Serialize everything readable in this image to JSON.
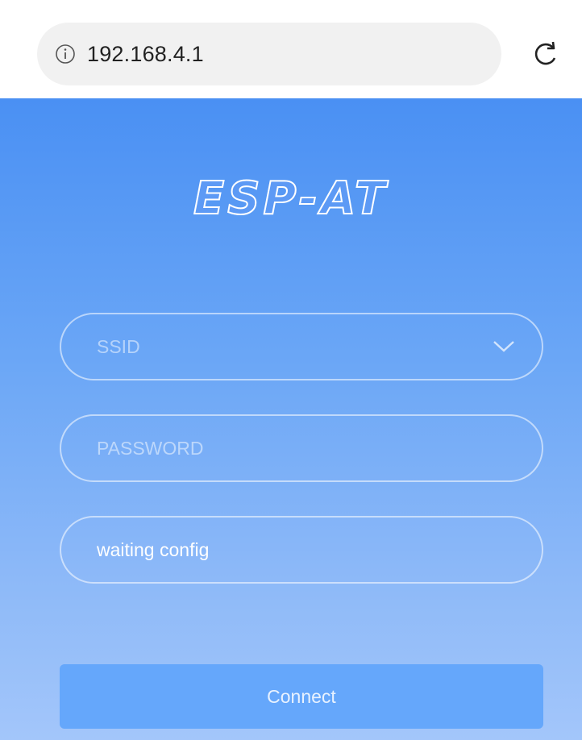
{
  "browser": {
    "url": "192.168.4.1",
    "info_icon": "info-icon",
    "reload_icon": "reload-icon"
  },
  "app": {
    "logo": "ESP-AT",
    "ssid_placeholder": "SSID",
    "password_placeholder": "PASSWORD",
    "status_value": "waiting config",
    "connect_label": "Connect",
    "colors": {
      "gradient_top": "#4a90f3",
      "gradient_bottom": "#a3c6fa",
      "button": "#65a7fb"
    }
  }
}
